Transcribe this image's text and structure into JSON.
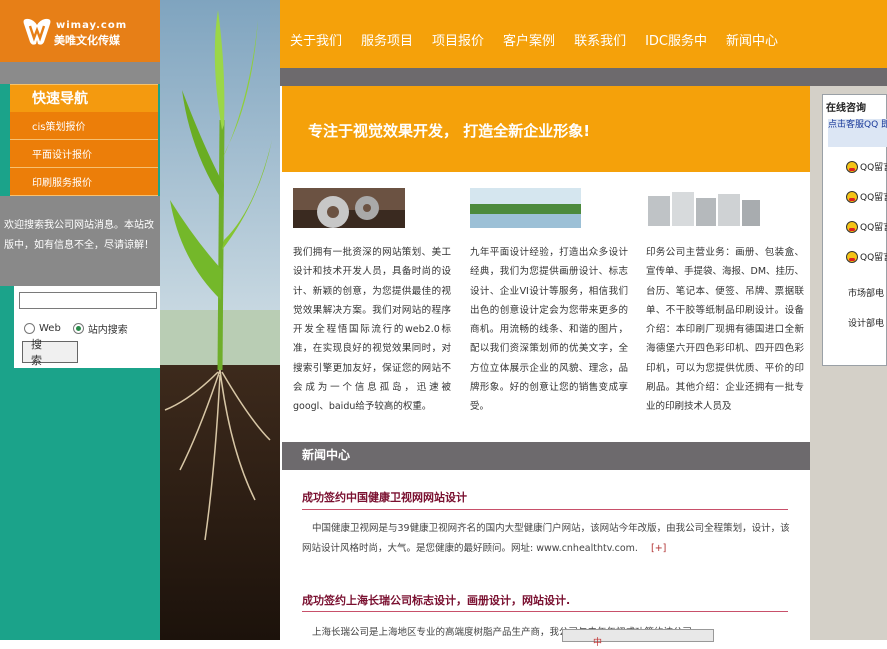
{
  "logo": {
    "en": "wimay.com",
    "cn": "美唯文化传媒"
  },
  "nav": {
    "items": [
      "关于我们",
      "服务项目",
      "项目报价",
      "客户案例",
      "联系我们",
      "IDC服务中",
      "新闻中心"
    ]
  },
  "sidebar": {
    "title": "快速导航",
    "items": [
      "cis策划报价",
      "平面设计报价",
      "印刷服务报价"
    ],
    "notice": "欢迎搜索我公司网站消息。本站改版中，如有信息不全，尽请谅解！"
  },
  "search": {
    "value": "",
    "options": [
      "Web",
      "站内搜索"
    ],
    "selected": "站内搜索",
    "button": "搜 索"
  },
  "banner": {
    "text": "专注于视觉效果开发，  打造全新企业形象!"
  },
  "columns": [
    {
      "text": "我们拥有一批资深的网站策划、美工设计和技术开发人员，具备时尚的设计、新颖的创意，为您提供最佳的视觉效果解决方案。我们对网站的程序开发全程悟国际流行的web2.0标准，在实现良好的视觉效果同时，对搜索引擎更加友好，保证您的网站不会成为一个信息孤岛，迅速被googl、baidu给予较高的权重。"
    },
    {
      "text": "九年平面设计经验，打造出众多设计经典，我们为您提供画册设计、标志设计、企业VI设计等服务，相信我们出色的创意设计定会为您带来更多的商机。用流畅的线条、和谐的图片，配以我们资深策划师的优美文字，全方位立体展示企业的风貌、理念，品牌形象。好的创意让您的销售变成享受。"
    },
    {
      "text": "印务公司主营业务：画册、包装盒、宣传单、手提袋、海报、DM、挂历、台历、笔记本、便签、吊牌、票据联单、不干胶等纸制品印刷设计。设备介绍：本印刷厂现拥有德国进口全新海德堡六开四色彩印机、四开四色彩印机，可以为您提供优质、平价的印刷品。其他介绍：企业还拥有一批专业的印刷技术人员及"
    }
  ],
  "news": {
    "title": "新闻中心",
    "items": [
      {
        "headline": "成功签约中国健康卫视网网站设计",
        "body": "中国健康卫视网是与39健康卫视网齐名的国内大型健康门户网站，该网站今年改版，由我公司全程策划，设计，该网站设计风格时尚，大气。是您健康的最好顾问。网址:",
        "url": "www.cnhealthtv.com.",
        "more": "[+]"
      },
      {
        "headline": "成功签约上海长瑞公司标志设计，画册设计，网站设计.",
        "body": "上海长瑞公司是上海地区专业的高端度树脂产品生产商，我公司与去年年初成功签约该公司"
      }
    ]
  },
  "consult": {
    "title": "在线咨询",
    "subtitle": "点击客服QQ 即时交谈或",
    "items": [
      "QQ留言",
      "QQ留言",
      "QQ留言",
      "QQ留言"
    ],
    "links": [
      "市场部电",
      "设计部电"
    ]
  },
  "float_toolbar": {
    "text": "中"
  }
}
